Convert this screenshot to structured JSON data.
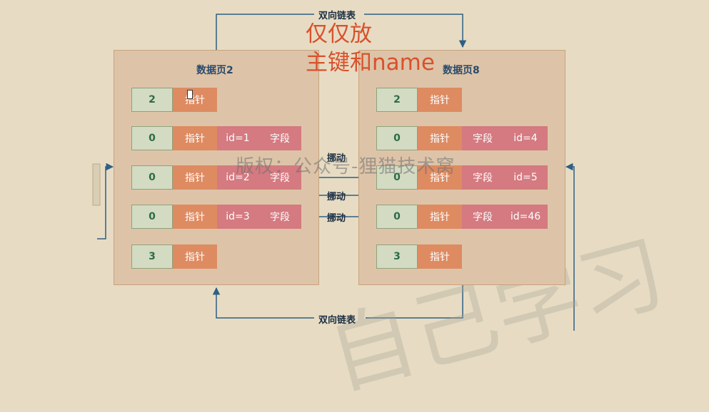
{
  "top_link_label": "双向链表",
  "bottom_link_label": "双向链表",
  "annotation": {
    "line1": "仅仅放",
    "line2": "主键和name"
  },
  "watermark": "版权：公众号-狸猫技术窝",
  "move_label": "挪动",
  "page2": {
    "title": "数据页2",
    "rows": [
      {
        "num": "2",
        "ptr": "指针"
      },
      {
        "num": "0",
        "ptr": "指针",
        "id": "id=1",
        "field": "字段"
      },
      {
        "num": "0",
        "ptr": "指针",
        "id": "id=2",
        "field": "字段"
      },
      {
        "num": "0",
        "ptr": "指针",
        "id": "id=3",
        "field": "字段"
      },
      {
        "num": "3",
        "ptr": "指针"
      }
    ]
  },
  "page8": {
    "title": "数据页8",
    "rows": [
      {
        "num": "2",
        "ptr": "指针"
      },
      {
        "num": "0",
        "ptr": "指针",
        "field": "字段",
        "id": "id=4"
      },
      {
        "num": "0",
        "ptr": "指针",
        "field": "字段",
        "id": "id=5"
      },
      {
        "num": "0",
        "ptr": "指针",
        "field": "字段",
        "id": "id=46"
      },
      {
        "num": "3",
        "ptr": "指针"
      }
    ]
  },
  "colors": {
    "background": "#e7dcc3",
    "page_fill": "#ddc4a8",
    "num_cell": "#d3dbc3",
    "pointer_cell": "#de8b62",
    "field_cell": "#d47a80",
    "arrows": "#2e5f86",
    "annotation": "#d9512d"
  }
}
